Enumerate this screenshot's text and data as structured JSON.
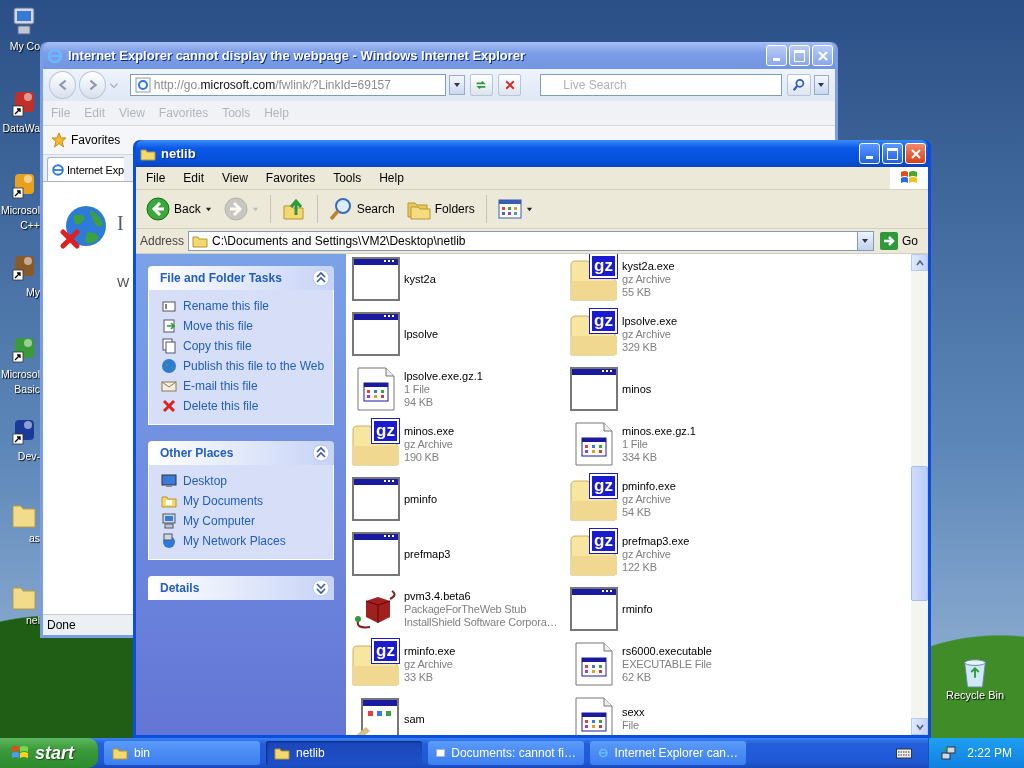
{
  "desktop": {
    "icons": [
      {
        "kind": "computer",
        "shortcut": false,
        "lines": [
          "My Co"
        ]
      },
      {
        "kind": "red-app",
        "shortcut": true,
        "lines": [
          "DataWa"
        ]
      },
      {
        "kind": "color-app",
        "shortcut": true,
        "lines": [
          "Microsol",
          "C++"
        ]
      },
      {
        "kind": "brown-app",
        "shortcut": true,
        "lines": [
          "My"
        ]
      },
      {
        "kind": "plant-app",
        "shortcut": true,
        "lines": [
          "Microsol",
          "Basic"
        ]
      },
      {
        "kind": "blue-app",
        "shortcut": true,
        "lines": [
          "Dev-"
        ]
      },
      {
        "kind": "folder",
        "shortcut": false,
        "lines": [
          "as"
        ]
      },
      {
        "kind": "folder",
        "shortcut": false,
        "lines": [
          "nel"
        ]
      }
    ],
    "recycle_bin": "Recycle Bin"
  },
  "browser": {
    "title": "Internet Explorer cannot display the webpage - Windows Internet Explorer",
    "address": [
      {
        "text": "http://go.",
        "strong": false
      },
      {
        "text": "microsoft.com",
        "strong": true
      },
      {
        "text": "/fwlink/?LinkId=69157",
        "strong": false
      }
    ],
    "search_placeholder": "Live Search",
    "menu": [
      {
        "label": "File",
        "disabled": true
      },
      {
        "label": "Edit",
        "disabled": true
      },
      {
        "label": "View",
        "disabled": true
      },
      {
        "label": "Favorites",
        "disabled": true
      },
      {
        "label": "Tools",
        "disabled": true
      },
      {
        "label": "Help",
        "disabled": true
      }
    ],
    "favorites": "Favorites",
    "tab": "Internet Exp",
    "heading": "I",
    "body": "W",
    "status": "Done"
  },
  "explorer": {
    "title": "netlib",
    "menu": [
      "File",
      "Edit",
      "View",
      "Favorites",
      "Tools",
      "Help"
    ],
    "toolbar": [
      {
        "kind": "back",
        "label": "Back",
        "disabled": false
      },
      {
        "kind": "forward",
        "disabled": true
      },
      {
        "kind": "up",
        "disabled": false
      },
      {
        "kind": "search",
        "label": "Search",
        "disabled": false
      },
      {
        "kind": "folders",
        "label": "Folders",
        "disabled": false
      },
      {
        "kind": "views",
        "disabled": false
      }
    ],
    "address_label": "Address",
    "address": "C:\\Documents and Settings\\VM2\\Desktop\\netlib",
    "go": "Go",
    "panels": [
      {
        "title": "File and Folder Tasks",
        "expanded": true,
        "items": [
          {
            "kind": "rename",
            "label": "Rename this file"
          },
          {
            "kind": "move",
            "label": "Move this file"
          },
          {
            "kind": "copy",
            "label": "Copy this file"
          },
          {
            "kind": "web",
            "label": "Publish this file to the Web"
          },
          {
            "kind": "email",
            "label": "E-mail this file"
          },
          {
            "kind": "delete",
            "label": "Delete this file"
          }
        ]
      },
      {
        "title": "Other Places",
        "expanded": true,
        "items": [
          {
            "kind": "desktop",
            "label": "Desktop"
          },
          {
            "kind": "documents",
            "label": "My Documents"
          },
          {
            "kind": "computer",
            "label": "My Computer"
          },
          {
            "kind": "network",
            "label": "My Network Places"
          }
        ]
      },
      {
        "title": "Details",
        "expanded": false
      }
    ],
    "files": [
      {
        "name": "kyst2a",
        "kind": "program"
      },
      {
        "name": "kyst2a.exe",
        "kind": "archive",
        "badge": "gz",
        "details": [
          "gz Archive",
          "55 KB"
        ]
      },
      {
        "name": "lpsolve",
        "kind": "program"
      },
      {
        "name": "lpsolve.exe",
        "kind": "archive",
        "badge": "gz",
        "details": [
          "gz Archive",
          "329 KB"
        ]
      },
      {
        "name": "lpsolve.exe.gz.1",
        "kind": "document",
        "details": [
          "1 File",
          "94 KB"
        ]
      },
      {
        "name": "minos",
        "kind": "program"
      },
      {
        "name": "minos.exe",
        "kind": "archive",
        "badge": "gz",
        "details": [
          "gz Archive",
          "190 KB"
        ]
      },
      {
        "name": "minos.exe.gz.1",
        "kind": "document",
        "details": [
          "1 File",
          "334 KB"
        ]
      },
      {
        "name": "pminfo",
        "kind": "program"
      },
      {
        "name": "pminfo.exe",
        "kind": "archive",
        "badge": "gz",
        "details": [
          "gz Archive",
          "54 KB"
        ]
      },
      {
        "name": "prefmap3",
        "kind": "program"
      },
      {
        "name": "prefmap3.exe",
        "kind": "archive",
        "badge": "gz",
        "details": [
          "gz Archive",
          "122 KB"
        ]
      },
      {
        "name": "pvm3.4.beta6",
        "kind": "package",
        "details": [
          "PackageForTheWeb Stub",
          "InstallShield Software Corpora…"
        ]
      },
      {
        "name": "rminfo",
        "kind": "program"
      },
      {
        "name": "rminfo.exe",
        "kind": "archive",
        "badge": "gz",
        "details": [
          "gz Archive",
          "33 KB"
        ]
      },
      {
        "name": "rs6000.executable",
        "kind": "document",
        "details": [
          "EXECUTABLE File",
          "62 KB"
        ]
      },
      {
        "name": "sam",
        "kind": "setup"
      },
      {
        "name": "sexx",
        "kind": "document",
        "details": [
          "File"
        ]
      }
    ]
  },
  "taskbar": {
    "start": "start",
    "tasks": [
      {
        "kind": "folder",
        "label": "bin",
        "selected": false
      },
      {
        "kind": "folder",
        "label": "netlib",
        "selected": true
      },
      {
        "kind": "window",
        "label": "Documents: cannot fi…",
        "selected": false
      },
      {
        "kind": "browser",
        "label": "Internet Explorer can…",
        "selected": false
      }
    ],
    "clock": "2:22 PM"
  }
}
